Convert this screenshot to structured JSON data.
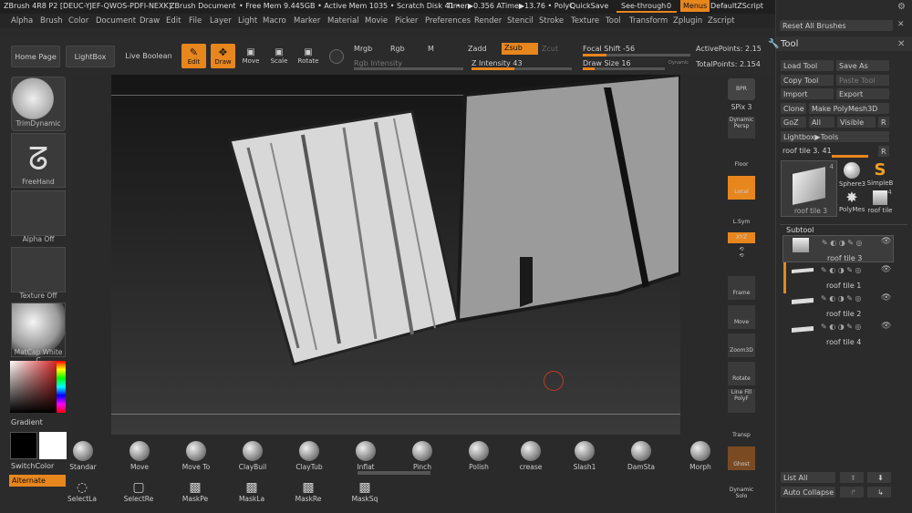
{
  "title_bar": {
    "app": "ZBrush 4R8 P2 [DEUC-YJEF-QWOS-PDFI-NEXK]",
    "doc": "ZBrush Document",
    "mem": "• Free Mem 9.445GB • Active Mem 1035 • Scratch Disk 41 •",
    "timer": "Timer▶0.356 ATime▶13.76 • PolyC",
    "quicksave": "QuickSave",
    "seethrough": "See-through",
    "seethrough_value": "0",
    "menus": "Menus",
    "script": "DefaultZScript"
  },
  "menu_items": [
    "Alpha",
    "Brush",
    "Color",
    "Document",
    "Draw",
    "Edit",
    "File",
    "Layer",
    "Light",
    "Macro",
    "Marker",
    "Material",
    "Movie",
    "Picker",
    "Preferences",
    "Render",
    "Stencil",
    "Stroke",
    "Texture",
    "Tool",
    "Transform",
    "Zplugin",
    "Zscript"
  ],
  "top_toolbar": {
    "home": "Home Page",
    "lightbox": "LightBox",
    "live_boolean": "Live Boolean",
    "edit": "Edit",
    "draw": "Draw",
    "move": "Move",
    "scale": "Scale",
    "rotate": "Rotate",
    "mrgb": "Mrgb",
    "rgb": "Rgb",
    "m": "M",
    "zadd": "Zadd",
    "zsub": "Zsub",
    "zcut": "Zcut",
    "rgb_intensity": "Rgb Intensity",
    "z_intensity": "Z Intensity 43",
    "focal_shift": "Focal Shift -56",
    "draw_size": "Draw Size 16",
    "dynamic": "Dynamic",
    "active_points": "ActivePoints: 2.15",
    "total_points": "TotalPoints: 2.154"
  },
  "left_shelf": {
    "brush": "TrimDynamic",
    "stroke": "FreeHand",
    "alpha": "Alpha Off",
    "texture": "Texture Off",
    "material": "MatCap White C",
    "gradient": "Gradient",
    "switch_color": "SwitchColor",
    "alternate": "Alternate"
  },
  "right_shelf": [
    "BPR",
    "SPix 3",
    "Dynamic Persp",
    "Floor",
    "Local",
    "L.Sym",
    "XYZ",
    "Frame",
    "Move",
    "Zoom3D",
    "Rotate",
    "Line Fill PolyF",
    "Transp",
    "Ghost",
    "Dynamic Solo"
  ],
  "tool_panel": {
    "reset_brushes": "Reset All Brushes",
    "title": "Tool",
    "load_tool": "Load Tool",
    "save_as": "Save As",
    "copy_tool": "Copy Tool",
    "paste_tool": "Paste Tool",
    "import": "Import",
    "export": "Export",
    "clone": "Clone",
    "make_polymesh": "Make PolyMesh3D",
    "goz": "GoZ",
    "all": "All",
    "visible": "Visible",
    "r": "R",
    "lightbox_tools": "Lightbox▶Tools",
    "current_tool": "roof tile 3. 41",
    "thumbs": [
      "roof tile 3",
      "Sphere3",
      "SimpleB",
      "PolyMes",
      "roof tile"
    ],
    "thumb_count_a": "4",
    "thumb_count_b": "4",
    "subtool_title": "Subtool",
    "subtools": [
      "roof tile 3",
      "roof tile 1",
      "roof tile 2",
      "roof tile 4"
    ],
    "list_all": "List All",
    "auto_collapse": "Auto Collapse"
  },
  "brushes": [
    "Standar",
    "Move",
    "Move To",
    "ClayBuil",
    "ClayTub",
    "Inflat",
    "Pinch",
    "Polish",
    "crease",
    "Slash1",
    "DamSta",
    "Morph"
  ],
  "strokes": [
    "SelectLa",
    "SelectRe",
    "MaskPe",
    "MaskLa",
    "MaskRe",
    "MaskSq"
  ]
}
